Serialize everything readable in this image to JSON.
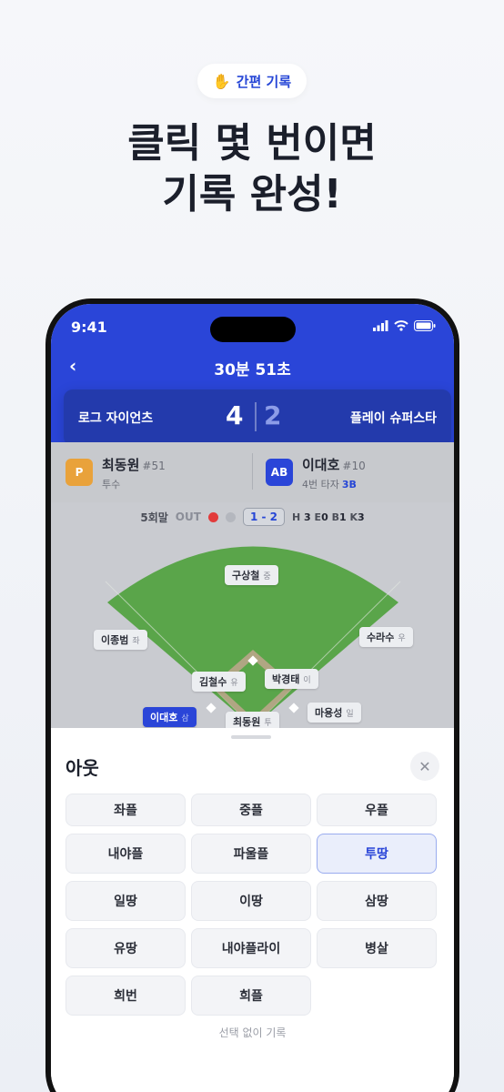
{
  "promo": {
    "badge_label": "간편 기록",
    "headline_line1": "클릭 몇 번이면",
    "headline_line2": "기록 완성!"
  },
  "status_bar": {
    "time": "9:41"
  },
  "header": {
    "timer": "30분 51초",
    "home_team": "로그 자이언츠",
    "away_team": "플레이 슈퍼스타",
    "home_score": "4",
    "away_score": "2"
  },
  "pitcher": {
    "badge": "P",
    "name": "최동원",
    "number": "#51",
    "role": "투수",
    "color": "#e9a23b"
  },
  "batter": {
    "badge": "AB",
    "name": "이대호",
    "number": "#10",
    "role": "4번 타자",
    "base": "3B",
    "color": "#2a45d8"
  },
  "inning": {
    "label": "5회말",
    "out_label": "OUT",
    "count": "1 - 2",
    "stats": {
      "h_label": "H",
      "h": "3",
      "e_label": "E",
      "e": "0",
      "b_label": "B",
      "b": "1",
      "k_label": "K",
      "k": "3"
    }
  },
  "fielders": {
    "cf": {
      "name": "구상철",
      "pos": "중"
    },
    "lf": {
      "name": "이종범",
      "pos": "좌"
    },
    "rf": {
      "name": "수라수",
      "pos": "우"
    },
    "ss": {
      "name": "김철수",
      "pos": "유"
    },
    "b2": {
      "name": "박경태",
      "pos": "이"
    },
    "runner": {
      "name": "이대호",
      "pos": "삼"
    },
    "p": {
      "name": "최동원",
      "pos": "투"
    },
    "b1": {
      "name": "마용성",
      "pos": "일"
    }
  },
  "sheet": {
    "title": "아웃",
    "options": [
      "좌플",
      "중플",
      "우플",
      "내야플",
      "파울플",
      "투땅",
      "일땅",
      "이땅",
      "삼땅",
      "유땅",
      "내야플라이",
      "병살",
      "희번",
      "희플"
    ],
    "selected": "투땅",
    "skip_label": "선택 없이 기록"
  }
}
